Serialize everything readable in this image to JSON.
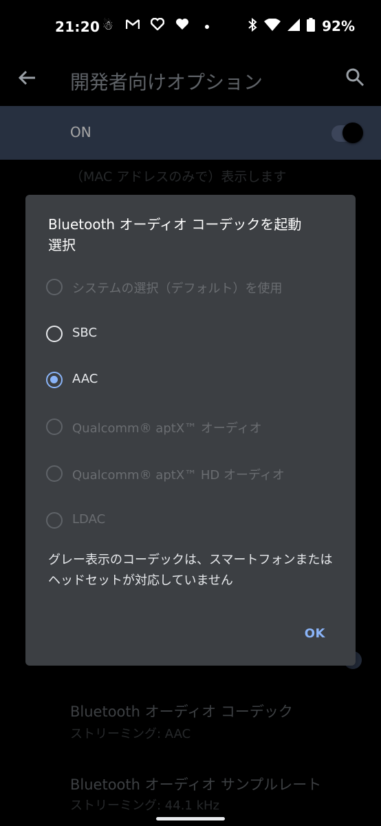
{
  "status_bar": {
    "time": "21:20",
    "battery": "92%",
    "notification_icons": [
      "app-icon",
      "gmail-icon",
      "heart-outline-icon",
      "heart-icon",
      "dot-icon"
    ],
    "right_icons": [
      "bluetooth-icon",
      "wifi-icon",
      "cellular-icon",
      "battery-icon"
    ]
  },
  "app_bar": {
    "title": "開発者向けオプション"
  },
  "master_switch": {
    "label": "ON",
    "state": "on"
  },
  "background": {
    "mac_text": "（MAC アドレスのみで）表示します",
    "prefs": [
      {
        "title": "Bluetooth オーディオ コーデック",
        "summary": "ストリーミング: AAC"
      },
      {
        "title": "Bluetooth オーディオ サンプルレート",
        "summary": "ストリーミング: 44.1 kHz"
      }
    ]
  },
  "dialog": {
    "title": "Bluetooth オーディオ コーデックを起動\n選択",
    "options": [
      {
        "label": "システムの選択（デフォルト）を使用",
        "enabled": false,
        "checked": false
      },
      {
        "label": "SBC",
        "enabled": true,
        "checked": false
      },
      {
        "label": "AAC",
        "enabled": true,
        "checked": true
      },
      {
        "label": "Qualcomm® aptX™ オーディオ",
        "enabled": false,
        "checked": false
      },
      {
        "label": "Qualcomm® aptX™ HD オーディオ",
        "enabled": false,
        "checked": false
      },
      {
        "label": "LDAC",
        "enabled": false,
        "checked": false
      }
    ],
    "note": "グレー表示のコーデックは、スマートフォンまたはヘッドセットが対応していません",
    "ok_label": "OK"
  },
  "colors": {
    "accent": "#8ab4f8",
    "dialog_bg": "#3c3f43",
    "switch_bar_bg": "#3d4a63"
  }
}
